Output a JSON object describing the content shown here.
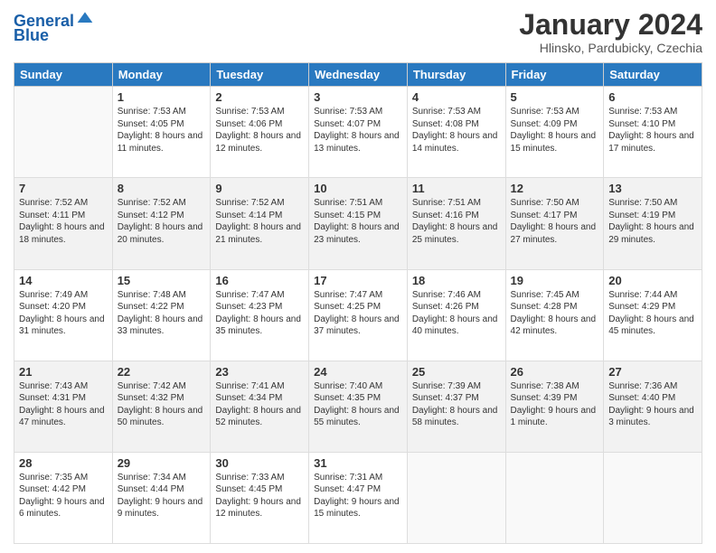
{
  "header": {
    "logo_line1": "General",
    "logo_line2": "Blue",
    "month_title": "January 2024",
    "subtitle": "Hlinsko, Pardubicky, Czechia"
  },
  "weekdays": [
    "Sunday",
    "Monday",
    "Tuesday",
    "Wednesday",
    "Thursday",
    "Friday",
    "Saturday"
  ],
  "weeks": [
    [
      {
        "day": "",
        "sunrise": "",
        "sunset": "",
        "daylight": ""
      },
      {
        "day": "1",
        "sunrise": "Sunrise: 7:53 AM",
        "sunset": "Sunset: 4:05 PM",
        "daylight": "Daylight: 8 hours and 11 minutes."
      },
      {
        "day": "2",
        "sunrise": "Sunrise: 7:53 AM",
        "sunset": "Sunset: 4:06 PM",
        "daylight": "Daylight: 8 hours and 12 minutes."
      },
      {
        "day": "3",
        "sunrise": "Sunrise: 7:53 AM",
        "sunset": "Sunset: 4:07 PM",
        "daylight": "Daylight: 8 hours and 13 minutes."
      },
      {
        "day": "4",
        "sunrise": "Sunrise: 7:53 AM",
        "sunset": "Sunset: 4:08 PM",
        "daylight": "Daylight: 8 hours and 14 minutes."
      },
      {
        "day": "5",
        "sunrise": "Sunrise: 7:53 AM",
        "sunset": "Sunset: 4:09 PM",
        "daylight": "Daylight: 8 hours and 15 minutes."
      },
      {
        "day": "6",
        "sunrise": "Sunrise: 7:53 AM",
        "sunset": "Sunset: 4:10 PM",
        "daylight": "Daylight: 8 hours and 17 minutes."
      }
    ],
    [
      {
        "day": "7",
        "sunrise": "Sunrise: 7:52 AM",
        "sunset": "Sunset: 4:11 PM",
        "daylight": "Daylight: 8 hours and 18 minutes."
      },
      {
        "day": "8",
        "sunrise": "Sunrise: 7:52 AM",
        "sunset": "Sunset: 4:12 PM",
        "daylight": "Daylight: 8 hours and 20 minutes."
      },
      {
        "day": "9",
        "sunrise": "Sunrise: 7:52 AM",
        "sunset": "Sunset: 4:14 PM",
        "daylight": "Daylight: 8 hours and 21 minutes."
      },
      {
        "day": "10",
        "sunrise": "Sunrise: 7:51 AM",
        "sunset": "Sunset: 4:15 PM",
        "daylight": "Daylight: 8 hours and 23 minutes."
      },
      {
        "day": "11",
        "sunrise": "Sunrise: 7:51 AM",
        "sunset": "Sunset: 4:16 PM",
        "daylight": "Daylight: 8 hours and 25 minutes."
      },
      {
        "day": "12",
        "sunrise": "Sunrise: 7:50 AM",
        "sunset": "Sunset: 4:17 PM",
        "daylight": "Daylight: 8 hours and 27 minutes."
      },
      {
        "day": "13",
        "sunrise": "Sunrise: 7:50 AM",
        "sunset": "Sunset: 4:19 PM",
        "daylight": "Daylight: 8 hours and 29 minutes."
      }
    ],
    [
      {
        "day": "14",
        "sunrise": "Sunrise: 7:49 AM",
        "sunset": "Sunset: 4:20 PM",
        "daylight": "Daylight: 8 hours and 31 minutes."
      },
      {
        "day": "15",
        "sunrise": "Sunrise: 7:48 AM",
        "sunset": "Sunset: 4:22 PM",
        "daylight": "Daylight: 8 hours and 33 minutes."
      },
      {
        "day": "16",
        "sunrise": "Sunrise: 7:47 AM",
        "sunset": "Sunset: 4:23 PM",
        "daylight": "Daylight: 8 hours and 35 minutes."
      },
      {
        "day": "17",
        "sunrise": "Sunrise: 7:47 AM",
        "sunset": "Sunset: 4:25 PM",
        "daylight": "Daylight: 8 hours and 37 minutes."
      },
      {
        "day": "18",
        "sunrise": "Sunrise: 7:46 AM",
        "sunset": "Sunset: 4:26 PM",
        "daylight": "Daylight: 8 hours and 40 minutes."
      },
      {
        "day": "19",
        "sunrise": "Sunrise: 7:45 AM",
        "sunset": "Sunset: 4:28 PM",
        "daylight": "Daylight: 8 hours and 42 minutes."
      },
      {
        "day": "20",
        "sunrise": "Sunrise: 7:44 AM",
        "sunset": "Sunset: 4:29 PM",
        "daylight": "Daylight: 8 hours and 45 minutes."
      }
    ],
    [
      {
        "day": "21",
        "sunrise": "Sunrise: 7:43 AM",
        "sunset": "Sunset: 4:31 PM",
        "daylight": "Daylight: 8 hours and 47 minutes."
      },
      {
        "day": "22",
        "sunrise": "Sunrise: 7:42 AM",
        "sunset": "Sunset: 4:32 PM",
        "daylight": "Daylight: 8 hours and 50 minutes."
      },
      {
        "day": "23",
        "sunrise": "Sunrise: 7:41 AM",
        "sunset": "Sunset: 4:34 PM",
        "daylight": "Daylight: 8 hours and 52 minutes."
      },
      {
        "day": "24",
        "sunrise": "Sunrise: 7:40 AM",
        "sunset": "Sunset: 4:35 PM",
        "daylight": "Daylight: 8 hours and 55 minutes."
      },
      {
        "day": "25",
        "sunrise": "Sunrise: 7:39 AM",
        "sunset": "Sunset: 4:37 PM",
        "daylight": "Daylight: 8 hours and 58 minutes."
      },
      {
        "day": "26",
        "sunrise": "Sunrise: 7:38 AM",
        "sunset": "Sunset: 4:39 PM",
        "daylight": "Daylight: 9 hours and 1 minute."
      },
      {
        "day": "27",
        "sunrise": "Sunrise: 7:36 AM",
        "sunset": "Sunset: 4:40 PM",
        "daylight": "Daylight: 9 hours and 3 minutes."
      }
    ],
    [
      {
        "day": "28",
        "sunrise": "Sunrise: 7:35 AM",
        "sunset": "Sunset: 4:42 PM",
        "daylight": "Daylight: 9 hours and 6 minutes."
      },
      {
        "day": "29",
        "sunrise": "Sunrise: 7:34 AM",
        "sunset": "Sunset: 4:44 PM",
        "daylight": "Daylight: 9 hours and 9 minutes."
      },
      {
        "day": "30",
        "sunrise": "Sunrise: 7:33 AM",
        "sunset": "Sunset: 4:45 PM",
        "daylight": "Daylight: 9 hours and 12 minutes."
      },
      {
        "day": "31",
        "sunrise": "Sunrise: 7:31 AM",
        "sunset": "Sunset: 4:47 PM",
        "daylight": "Daylight: 9 hours and 15 minutes."
      },
      {
        "day": "",
        "sunrise": "",
        "sunset": "",
        "daylight": ""
      },
      {
        "day": "",
        "sunrise": "",
        "sunset": "",
        "daylight": ""
      },
      {
        "day": "",
        "sunrise": "",
        "sunset": "",
        "daylight": ""
      }
    ]
  ]
}
